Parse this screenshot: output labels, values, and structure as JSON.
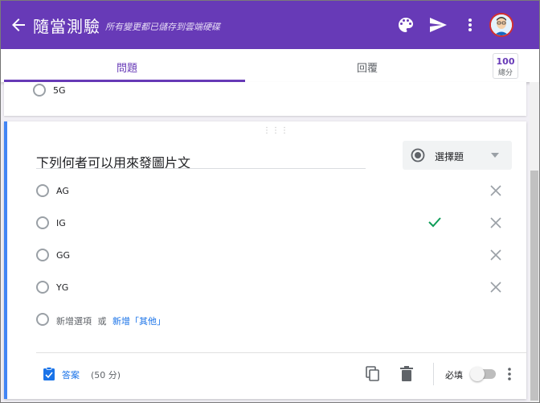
{
  "header": {
    "title": "隨當測驗",
    "save_status": "所有變更都已儲存到雲端硬碟"
  },
  "tabs": [
    {
      "label": "問題",
      "active": true
    },
    {
      "label": "回覆",
      "active": false
    }
  ],
  "score": {
    "value": "100",
    "label": "總分"
  },
  "previous_option": {
    "label": "5G"
  },
  "question": {
    "title": "下列何者可以用來發圖片文",
    "type": "選擇題",
    "options": [
      {
        "label": "AG",
        "correct": false
      },
      {
        "label": "IG",
        "correct": true
      },
      {
        "label": "GG",
        "correct": false
      },
      {
        "label": "YG",
        "correct": false
      }
    ],
    "add_option": "新增選項",
    "or_text": "或",
    "add_other": "新增「其他」"
  },
  "footer": {
    "answer_label": "答案",
    "points": "(50 分)",
    "required_label": "必填",
    "required": false
  },
  "colors": {
    "brand": "#673ab7",
    "accent": "#4285f4",
    "link": "#1a73e8",
    "correct": "#0f9d58"
  }
}
